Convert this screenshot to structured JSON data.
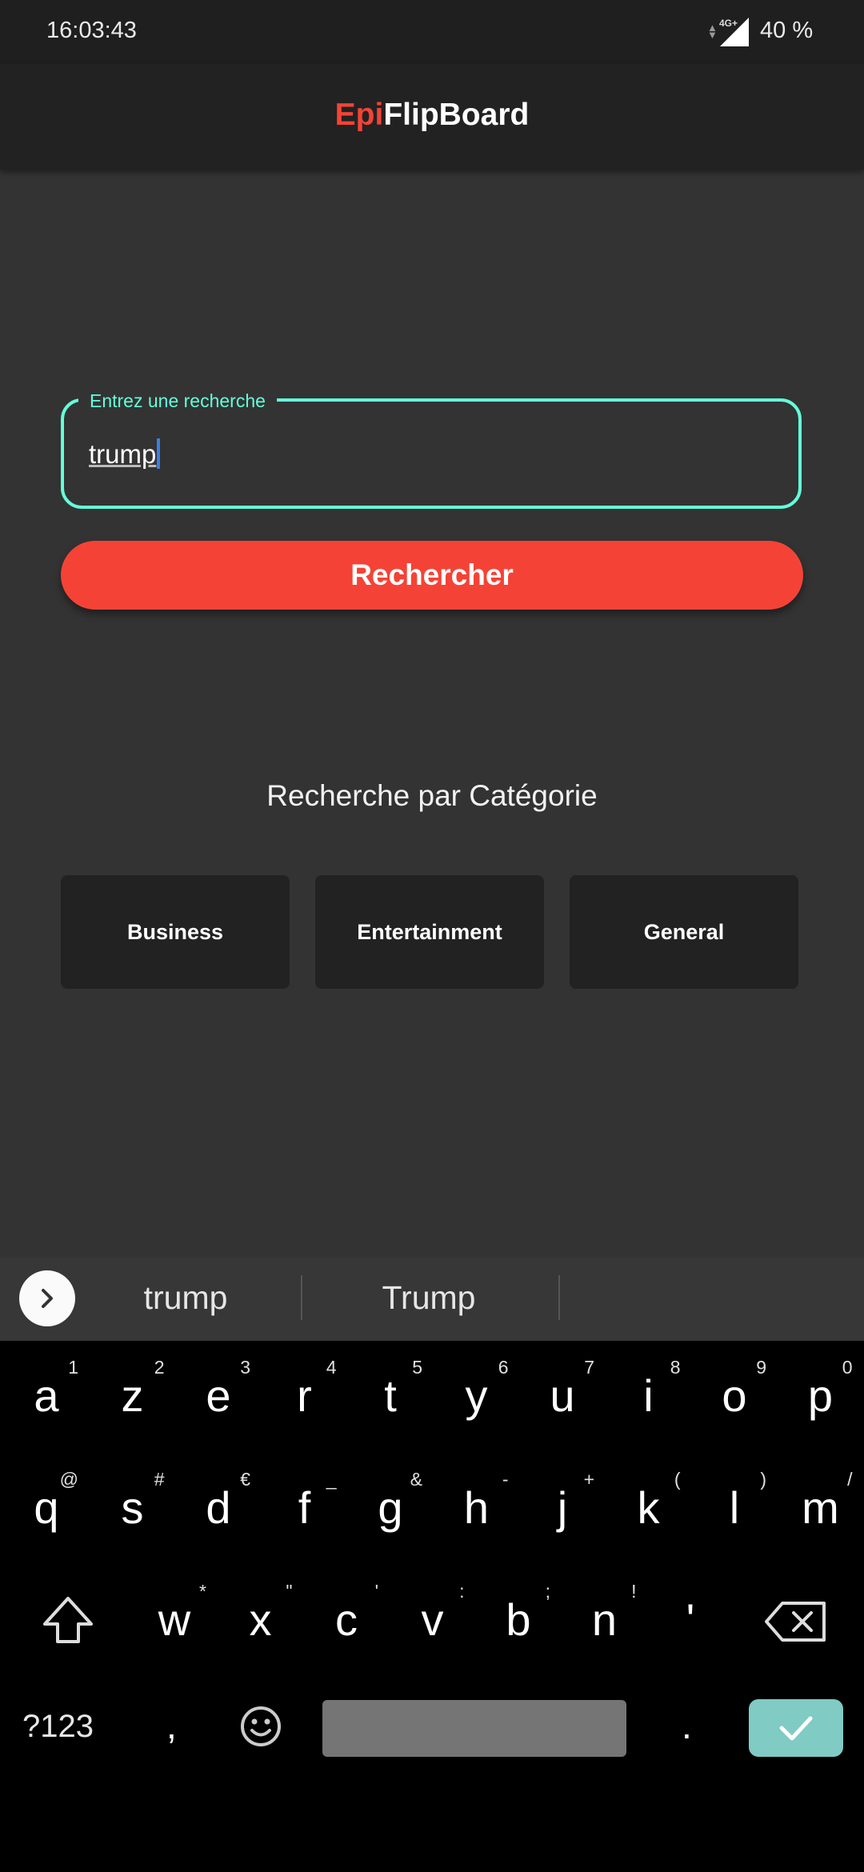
{
  "status_bar": {
    "time": "16:03:43",
    "network": "4G+",
    "battery": "40 %"
  },
  "app_bar": {
    "title_accent": "Epi",
    "title_rest": "FlipBoard",
    "accent_color": "#f44336"
  },
  "search": {
    "label": "Entrez une recherche",
    "value": "trump",
    "border_color": "#64ffda"
  },
  "search_button": {
    "label": "Rechercher"
  },
  "categories": {
    "title": "Recherche par Catégorie",
    "items": [
      "Business",
      "Entertainment",
      "General"
    ]
  },
  "suggestions": {
    "items": [
      "trump",
      "Trump"
    ]
  },
  "keyboard": {
    "row1": [
      {
        "k": "a",
        "s": "1"
      },
      {
        "k": "z",
        "s": "2"
      },
      {
        "k": "e",
        "s": "3"
      },
      {
        "k": "r",
        "s": "4"
      },
      {
        "k": "t",
        "s": "5"
      },
      {
        "k": "y",
        "s": "6"
      },
      {
        "k": "u",
        "s": "7"
      },
      {
        "k": "i",
        "s": "8"
      },
      {
        "k": "o",
        "s": "9"
      },
      {
        "k": "p",
        "s": "0"
      }
    ],
    "row2": [
      {
        "k": "q",
        "s": "@"
      },
      {
        "k": "s",
        "s": "#"
      },
      {
        "k": "d",
        "s": "€"
      },
      {
        "k": "f",
        "s": "_"
      },
      {
        "k": "g",
        "s": "&"
      },
      {
        "k": "h",
        "s": "-"
      },
      {
        "k": "j",
        "s": "+"
      },
      {
        "k": "k",
        "s": "("
      },
      {
        "k": "l",
        "s": ")"
      },
      {
        "k": "m",
        "s": "/"
      }
    ],
    "row3": [
      {
        "k": "w",
        "s": "*"
      },
      {
        "k": "x",
        "s": "\""
      },
      {
        "k": "c",
        "s": "'"
      },
      {
        "k": "v",
        "s": ":"
      },
      {
        "k": "b",
        "s": ";"
      },
      {
        "k": "n",
        "s": "!"
      },
      {
        "k": "'",
        "s": ""
      }
    ],
    "symbols_label": "?123",
    "comma": ",",
    "period": ".",
    "enter_color": "#80cbc4"
  },
  "icons": {
    "shift": "shift-icon",
    "backspace": "backspace-icon",
    "emoji": "emoji-icon",
    "enter": "checkmark-icon",
    "suggest_toggle": "chevron-right-icon",
    "signal": "signal-icon"
  }
}
